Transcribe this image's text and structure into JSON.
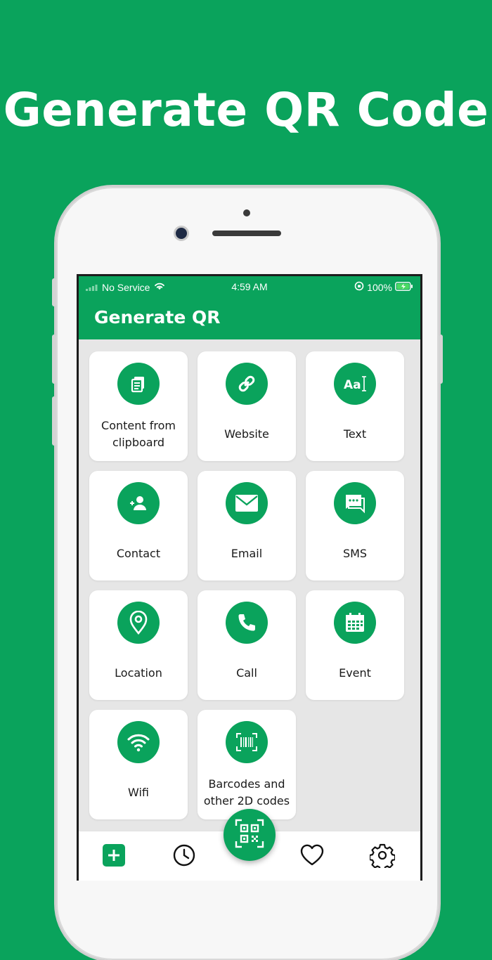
{
  "headline": "Generate QR Code",
  "status_bar": {
    "carrier": "No Service",
    "time": "4:59 AM",
    "battery": "100%"
  },
  "app_bar": {
    "title": "Generate QR"
  },
  "items": [
    {
      "label": "Content from clipboard",
      "icon": "clipboard-icon"
    },
    {
      "label": "Website",
      "icon": "link-icon"
    },
    {
      "label": "Text",
      "icon": "text-icon"
    },
    {
      "label": "Contact",
      "icon": "contact-icon"
    },
    {
      "label": "Email",
      "icon": "email-icon"
    },
    {
      "label": "SMS",
      "icon": "sms-icon"
    },
    {
      "label": "Location",
      "icon": "location-icon"
    },
    {
      "label": "Call",
      "icon": "phone-icon"
    },
    {
      "label": "Event",
      "icon": "calendar-icon"
    },
    {
      "label": "Wifi",
      "icon": "wifi-icon"
    },
    {
      "label": "Barcodes and other 2D codes",
      "icon": "barcode-icon"
    }
  ],
  "bottom_nav": [
    "add-icon",
    "history-icon",
    "scan-qr-icon",
    "heart-icon",
    "settings-icon"
  ],
  "colors": {
    "brand": "#0aa35c",
    "background": "#e6e6e6",
    "card": "#ffffff"
  }
}
